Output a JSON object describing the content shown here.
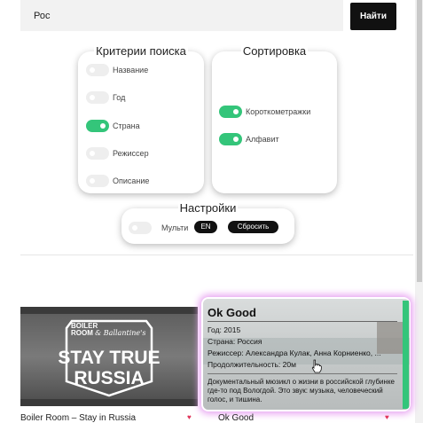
{
  "search": {
    "value": "Рос",
    "button": "Найти"
  },
  "criteria": {
    "title": "Критерии поиска",
    "items": [
      {
        "label": "Название",
        "on": false
      },
      {
        "label": "Год",
        "on": false
      },
      {
        "label": "Страна",
        "on": true
      },
      {
        "label": "Режиссер",
        "on": false
      },
      {
        "label": "Описание",
        "on": false
      }
    ]
  },
  "sorting": {
    "title": "Сортировка",
    "items": [
      {
        "label": "Короткометражки",
        "on": true
      },
      {
        "label": "Алфавит",
        "on": true
      }
    ]
  },
  "settings": {
    "title": "Настройки",
    "multi_label": "Мульти",
    "multi_on": false,
    "lang_button": "EN",
    "reset_button": "Сбросить"
  },
  "cards": [
    {
      "title": "Boiler Room – Stay in Russia",
      "poster": {
        "brand_line1": "BOILER",
        "brand_line2": "ROOM",
        "brand_partner": "& Ballantine's",
        "line1": "STAY TRUE",
        "line2": "RUSSIA"
      },
      "liked": true
    },
    {
      "title": "Ok Good",
      "liked": true,
      "details": {
        "heading": "Ok Good",
        "year": "Год: 2015",
        "country": "Страна: Россия",
        "director": "Режиссер: Александра Кулак, Анна Корниенко, ...",
        "duration": "Продолжительность: 20м",
        "description": "Документальный мюзикл о жизни в российской глубинке где-то под Вологдой. Это звук: музыка, человеческий голос, и тишина."
      }
    }
  ],
  "icons": {
    "heart": "♥",
    "cursor": "hand-pointer-icon"
  },
  "colors": {
    "toggle_on": "#34c57a",
    "hover_glow": "#e9a8f2",
    "heart": "#e0335a"
  }
}
